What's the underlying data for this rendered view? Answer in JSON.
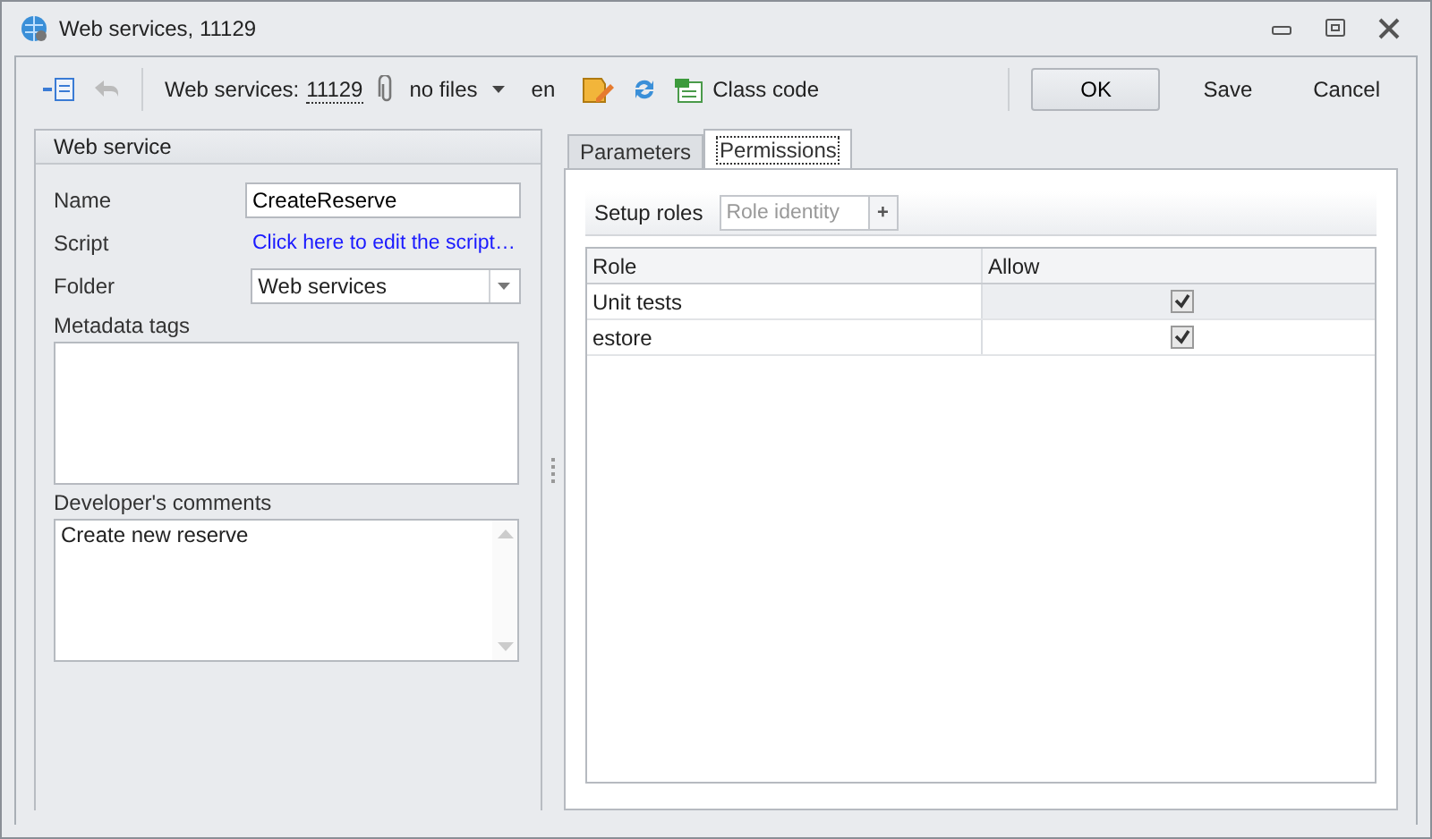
{
  "window": {
    "title": "Web services, 11129"
  },
  "toolbar": {
    "label": "Web services:",
    "id": "11129",
    "files": "no files",
    "language": "en",
    "class_code": "Class code"
  },
  "buttons": [
    {
      "label": "OK",
      "kind": "primary"
    },
    {
      "label": "Save",
      "kind": "flat"
    },
    {
      "label": "Cancel",
      "kind": "flat"
    }
  ],
  "web_service": {
    "title": "Web service",
    "name_label": "Name",
    "name": "CreateReserve",
    "script_label": "Script",
    "script_link": "Click here to edit the script…",
    "folder_label": "Folder",
    "folder": "Web services",
    "tags_label": "Metadata tags",
    "comments_label": "Developer's comments",
    "comments": "Create new reserve"
  },
  "tabs": [
    {
      "label": "Parameters",
      "selected": false
    },
    {
      "label": "Permissions",
      "selected": true
    }
  ],
  "roles": {
    "label": "Setup roles",
    "placeholder": "Role identity",
    "add": "+"
  },
  "table": {
    "columns": [
      "Role",
      "Allow"
    ],
    "rows": [
      {
        "role": "Unit tests",
        "allow": true,
        "selected": true
      },
      {
        "role": "estore",
        "allow": true,
        "selected": false
      }
    ]
  }
}
